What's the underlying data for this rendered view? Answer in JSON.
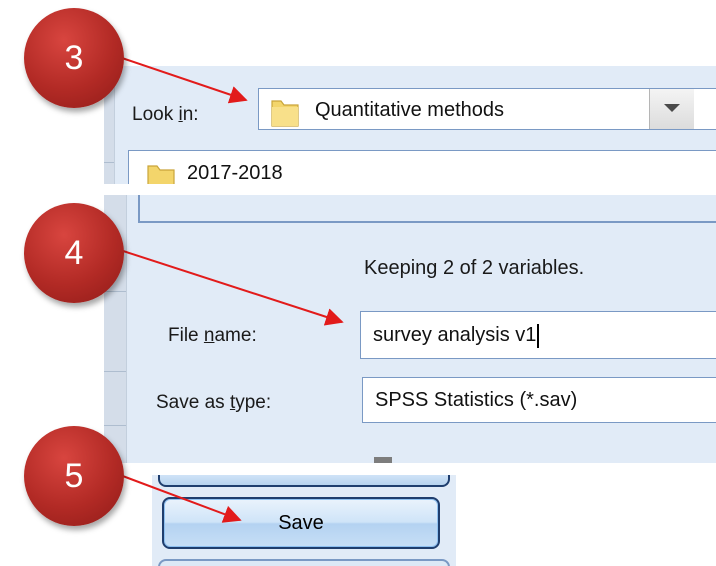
{
  "steps": {
    "step3": "3",
    "step4": "4",
    "step5": "5"
  },
  "look_in": {
    "label_pre": "Look ",
    "label_key": "i",
    "label_post": "n:",
    "selected": "Quantitative methods",
    "list_first_item": "2017-2018"
  },
  "status": {
    "keeping_text": "Keeping 2 of 2 variables."
  },
  "file_name": {
    "label_pre": "File ",
    "label_key": "n",
    "label_post": "ame:",
    "value": "survey analysis v1"
  },
  "save_as_type": {
    "label_pre": "Save as ",
    "label_key": "t",
    "label_post": "ype:",
    "value": "SPSS Statistics (*.sav)"
  },
  "buttons": {
    "save_label": "Save"
  },
  "colors": {
    "badge": "#b22a25",
    "arrow": "#e21b1b",
    "dialog_bg": "#e1ebf7",
    "field_border": "#7a99c4",
    "button_border": "#1f3e6e"
  }
}
